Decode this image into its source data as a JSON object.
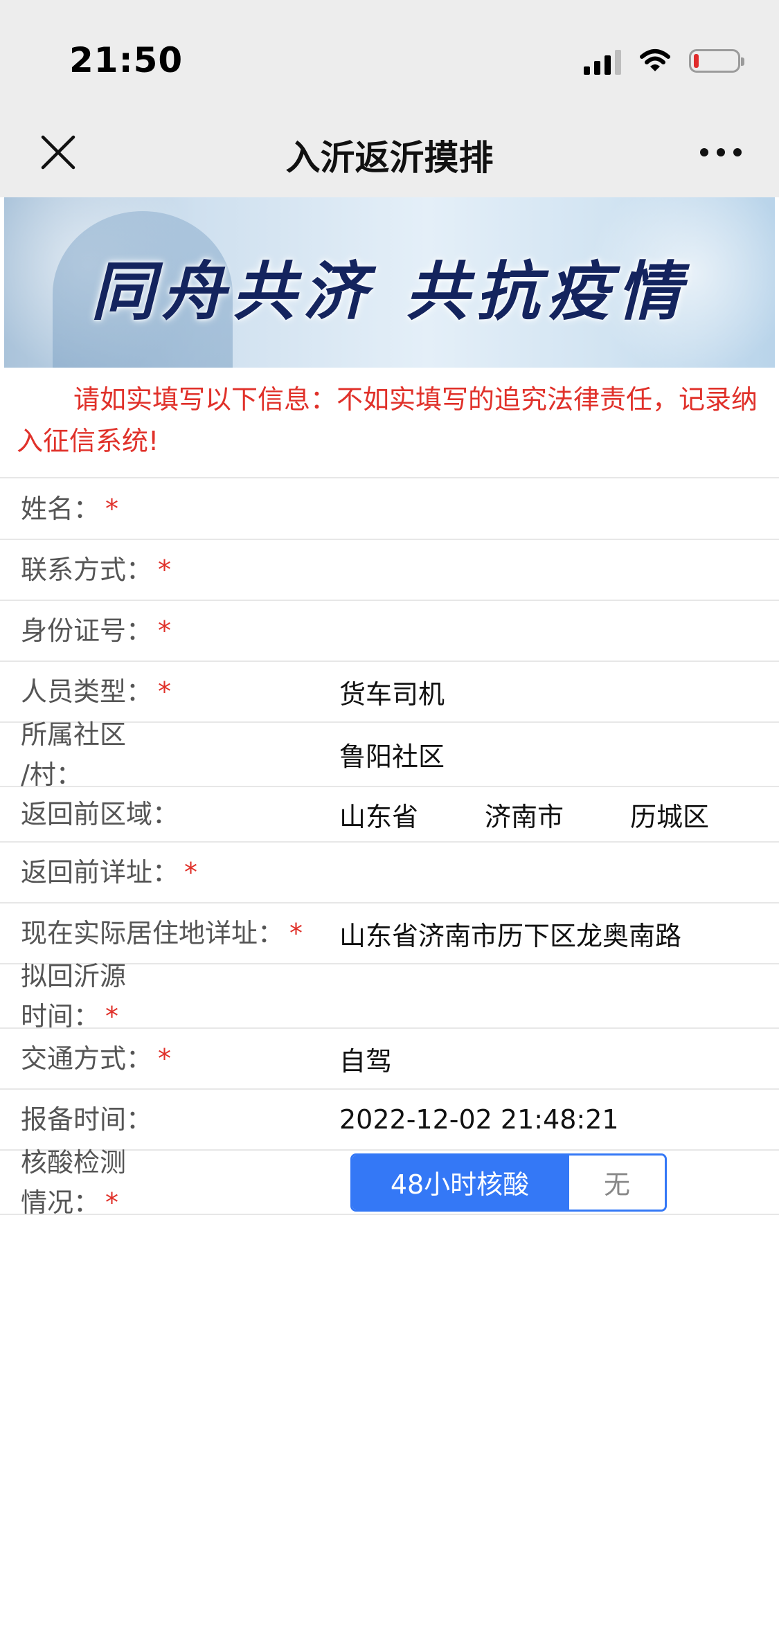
{
  "status_bar": {
    "time": "21:50"
  },
  "nav": {
    "title": "入沂返沂摸排"
  },
  "banner": {
    "slogan_part1": "同舟共济",
    "slogan_part2": "共抗疫情"
  },
  "notice": {
    "text": "请如实填写以下信息：不如实填写的追究法律责任，记录纳入征信系统!"
  },
  "form": {
    "name": {
      "label": "姓名：",
      "required": "*",
      "value": ""
    },
    "contact": {
      "label": "联系方式：",
      "required": "*",
      "value": ""
    },
    "id_number": {
      "label": "身份证号：",
      "required": "*",
      "value": ""
    },
    "person_type": {
      "label": "人员类型：",
      "required": "*",
      "value": "货车司机"
    },
    "community": {
      "label_line1": "所属社区",
      "label_line2": "/村：",
      "value": "鲁阳社区"
    },
    "prev_area": {
      "label": "返回前区域：",
      "province": "山东省",
      "city": "济南市",
      "district": "历城区"
    },
    "prev_address": {
      "label": "返回前详址：",
      "required": "*",
      "value": ""
    },
    "current_address": {
      "label": "现在实际居住地详址：",
      "required": "*",
      "value": "山东省济南市历下区龙奥南路"
    },
    "return_time": {
      "label_line1": "拟回沂源",
      "label_line2": "时间：",
      "required": "*",
      "value": ""
    },
    "transport": {
      "label": "交通方式：",
      "required": "*",
      "value": "自驾"
    },
    "report_time": {
      "label": "报备时间：",
      "value": "2022-12-02 21:48:21"
    },
    "nucleic": {
      "label_line1": "核酸检测",
      "label_line2": "情况：",
      "required": "*",
      "options": [
        "48小时核酸",
        "无"
      ],
      "selected": "48小时核酸"
    }
  },
  "colors": {
    "accent": "#3478f6",
    "required": "#e0312a",
    "notice": "#e0312a"
  },
  "icons": [
    "close-icon",
    "more-icon",
    "signal-icon",
    "wifi-icon",
    "battery-icon"
  ]
}
